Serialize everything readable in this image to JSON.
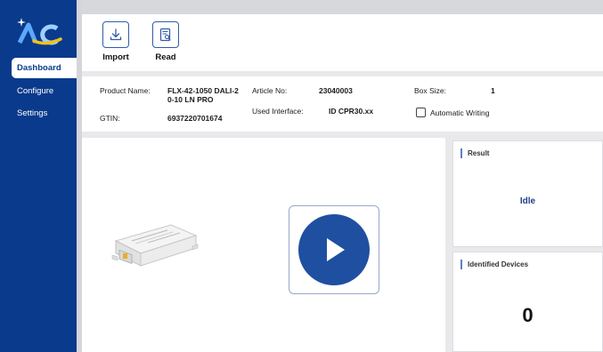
{
  "brand": {
    "logo_icon": "ac-logo-icon",
    "colors": {
      "sidebar": "#0a3a8c",
      "accent": "#1f4fa0",
      "yellow": "#f2c21b"
    }
  },
  "sidebar": {
    "items": [
      {
        "label": "Dashboard",
        "active": true
      },
      {
        "label": "Configure",
        "active": false
      },
      {
        "label": "Settings",
        "active": false
      }
    ]
  },
  "toolbar": {
    "import_label": "Import",
    "import_icon": "download-icon",
    "read_label": "Read",
    "read_icon": "document-search-icon"
  },
  "product": {
    "name_label": "Product Name:",
    "name_line1": "FLX-42-1050 DALI-2",
    "name_line2": "0-10 LN PRO",
    "article_label": "Article No:",
    "article_value": "23040003",
    "box_label": "Box Size:",
    "box_value": "1",
    "interface_label": "Used Interface:",
    "interface_value": "ID CPR30.xx",
    "auto_writing_label": "Automatic Writing",
    "gtin_label": "GTIN:",
    "gtin_value": "6937220701674"
  },
  "main": {
    "device_image": "led-driver-image",
    "play_icon": "play-icon"
  },
  "result": {
    "title": "Result",
    "status": "Idle"
  },
  "identified": {
    "title": "Identified Devices",
    "count": "0"
  }
}
